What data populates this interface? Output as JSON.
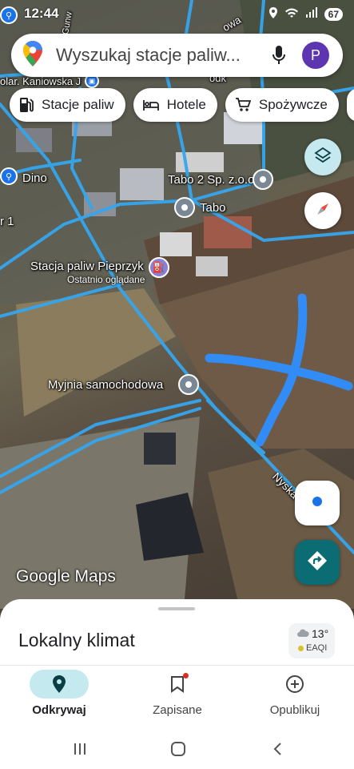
{
  "status_bar": {
    "time": "12:44",
    "battery": "67"
  },
  "search": {
    "placeholder": "Wyszukaj stacje paliw..."
  },
  "profile": {
    "initial": "P",
    "color": "#5e35b1"
  },
  "chips": [
    {
      "label": "Stacje paliw",
      "icon": "fuel-icon"
    },
    {
      "label": "Hotele",
      "icon": "bed-icon"
    },
    {
      "label": "Spożywcze",
      "icon": "cart-icon"
    }
  ],
  "map": {
    "labels": {
      "kaniowska": "olar. Kaniowska J",
      "dino": "Dino",
      "r1": "r 1",
      "tabo2": "Tabo 2 Sp. z.o.o",
      "tabo": "Tabo",
      "stacja": "Stacja paliw Pieprzyk",
      "stacja_sub": "Ostatnio oglądane",
      "myjnia": "Myjnia samochodowa",
      "nyska": "Nyska",
      "gunw": "Gunw",
      "odk": "odk",
      "nowa": "owa"
    },
    "attribution": "Google Maps"
  },
  "bottom_sheet": {
    "title": "Lokalny klimat",
    "weather": {
      "temp": "13°",
      "air_quality": "EAQI"
    }
  },
  "bottom_nav": [
    {
      "label": "Odkrywaj",
      "icon": "explore-pin-icon",
      "active": true
    },
    {
      "label": "Zapisane",
      "icon": "bookmark-icon",
      "active": false
    },
    {
      "label": "Opublikuj",
      "icon": "add-circle-icon",
      "active": false
    }
  ],
  "colors": {
    "road": "#35a6ee",
    "accent": "#0b6c73",
    "drawn_cross": "#2f8fff"
  }
}
